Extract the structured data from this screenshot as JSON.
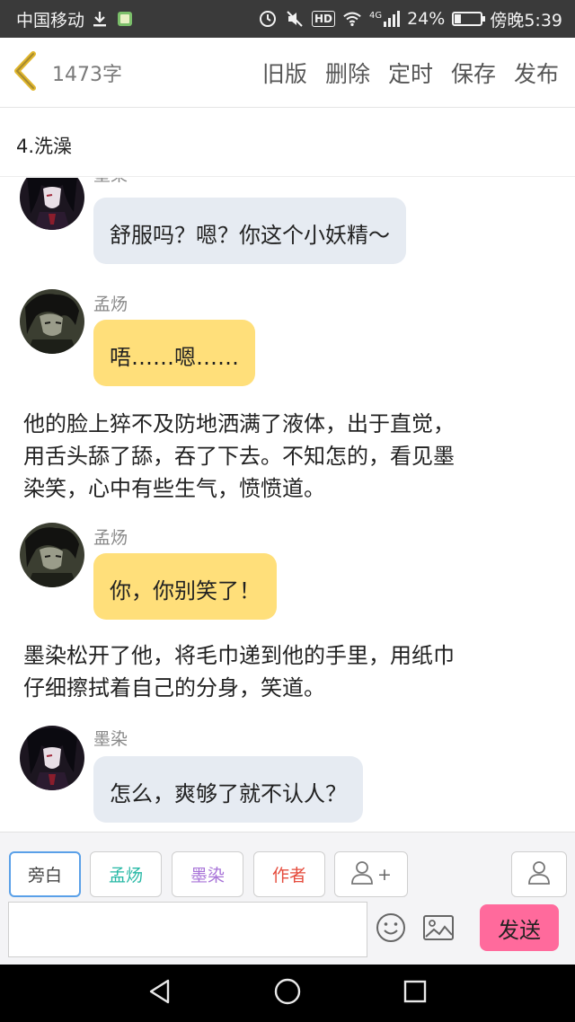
{
  "status_bar": {
    "carrier": "中国移动",
    "network_label": "HD",
    "signal_label": "4G",
    "battery_percent_text": "24%",
    "battery_level": 0.24,
    "time": "傍晚5:39"
  },
  "header": {
    "word_count": "1473字",
    "actions": [
      "旧版",
      "删除",
      "定时",
      "保存",
      "发布"
    ]
  },
  "chapter": {
    "title": "4.洗澡"
  },
  "messages": [
    {
      "sender": "墨染",
      "text": "舒服吗？嗯？你这个小妖精～"
    },
    {
      "sender": "孟炀",
      "text": "唔……嗯……"
    },
    {
      "narration": [
        "他的脸上猝不及防地洒满了液体，出于直觉，",
        "用舌头舔了舔，吞了下去。不知怎的，看见墨",
        "染笑，心中有些生气，愤愤道。"
      ]
    },
    {
      "sender": "孟炀",
      "text": "你，你别笑了！"
    },
    {
      "narration": [
        "墨染松开了他，将毛巾递到他的手里，用纸巾",
        "仔细擦拭着自己的分身，笑道。"
      ]
    },
    {
      "sender": "墨染",
      "text": "怎么，爽够了就不认人？"
    }
  ],
  "roles": [
    {
      "label": "旁白",
      "color": "#555555"
    },
    {
      "label": "孟炀",
      "color": "#26b8a5"
    },
    {
      "label": "墨染",
      "color": "#a874d8"
    },
    {
      "label": "作者",
      "color": "#e54b3c"
    }
  ],
  "add_role_label": "+",
  "composer": {
    "input_value": "",
    "send_label": "发送"
  },
  "icons": {
    "back": "chevron-left-icon",
    "add_person": "add-person-icon",
    "person": "person-icon",
    "emoji": "emoji-icon",
    "image": "image-icon",
    "nav_back": "triangle-back-icon",
    "nav_home": "circle-home-icon",
    "nav_recent": "square-recent-icon"
  },
  "colors": {
    "accent_back": "#e0b62c",
    "bubble_grey": "#e6ebf2",
    "bubble_yellow": "#ffdf7a",
    "send": "#ff6a9c",
    "selected_border": "#5aa0e8"
  }
}
